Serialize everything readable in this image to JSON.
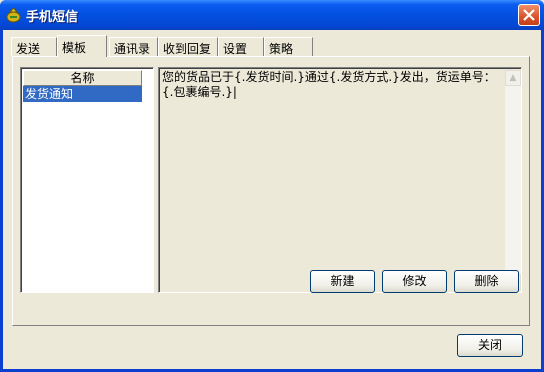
{
  "window": {
    "title": "手机短信"
  },
  "tabs": [
    {
      "label": "发送"
    },
    {
      "label": "模板"
    },
    {
      "label": "通讯录"
    },
    {
      "label": "收到回复"
    },
    {
      "label": "设置"
    },
    {
      "label": "策略"
    }
  ],
  "template_list": {
    "header": "名称",
    "items": [
      {
        "label": "发货通知",
        "selected": true
      }
    ]
  },
  "editor": {
    "text": "您的货品已于{.发货时间.}通过{.发货方式.}发出，货运单号：{.包裹编号.}|"
  },
  "actions": {
    "new_label": "新建",
    "edit_label": "修改",
    "delete_label": "删除"
  },
  "footer": {
    "close_label": "关闭"
  },
  "colors": {
    "title_bar": "#0450e0",
    "selection": "#316ac5",
    "face": "#ece9d8"
  }
}
